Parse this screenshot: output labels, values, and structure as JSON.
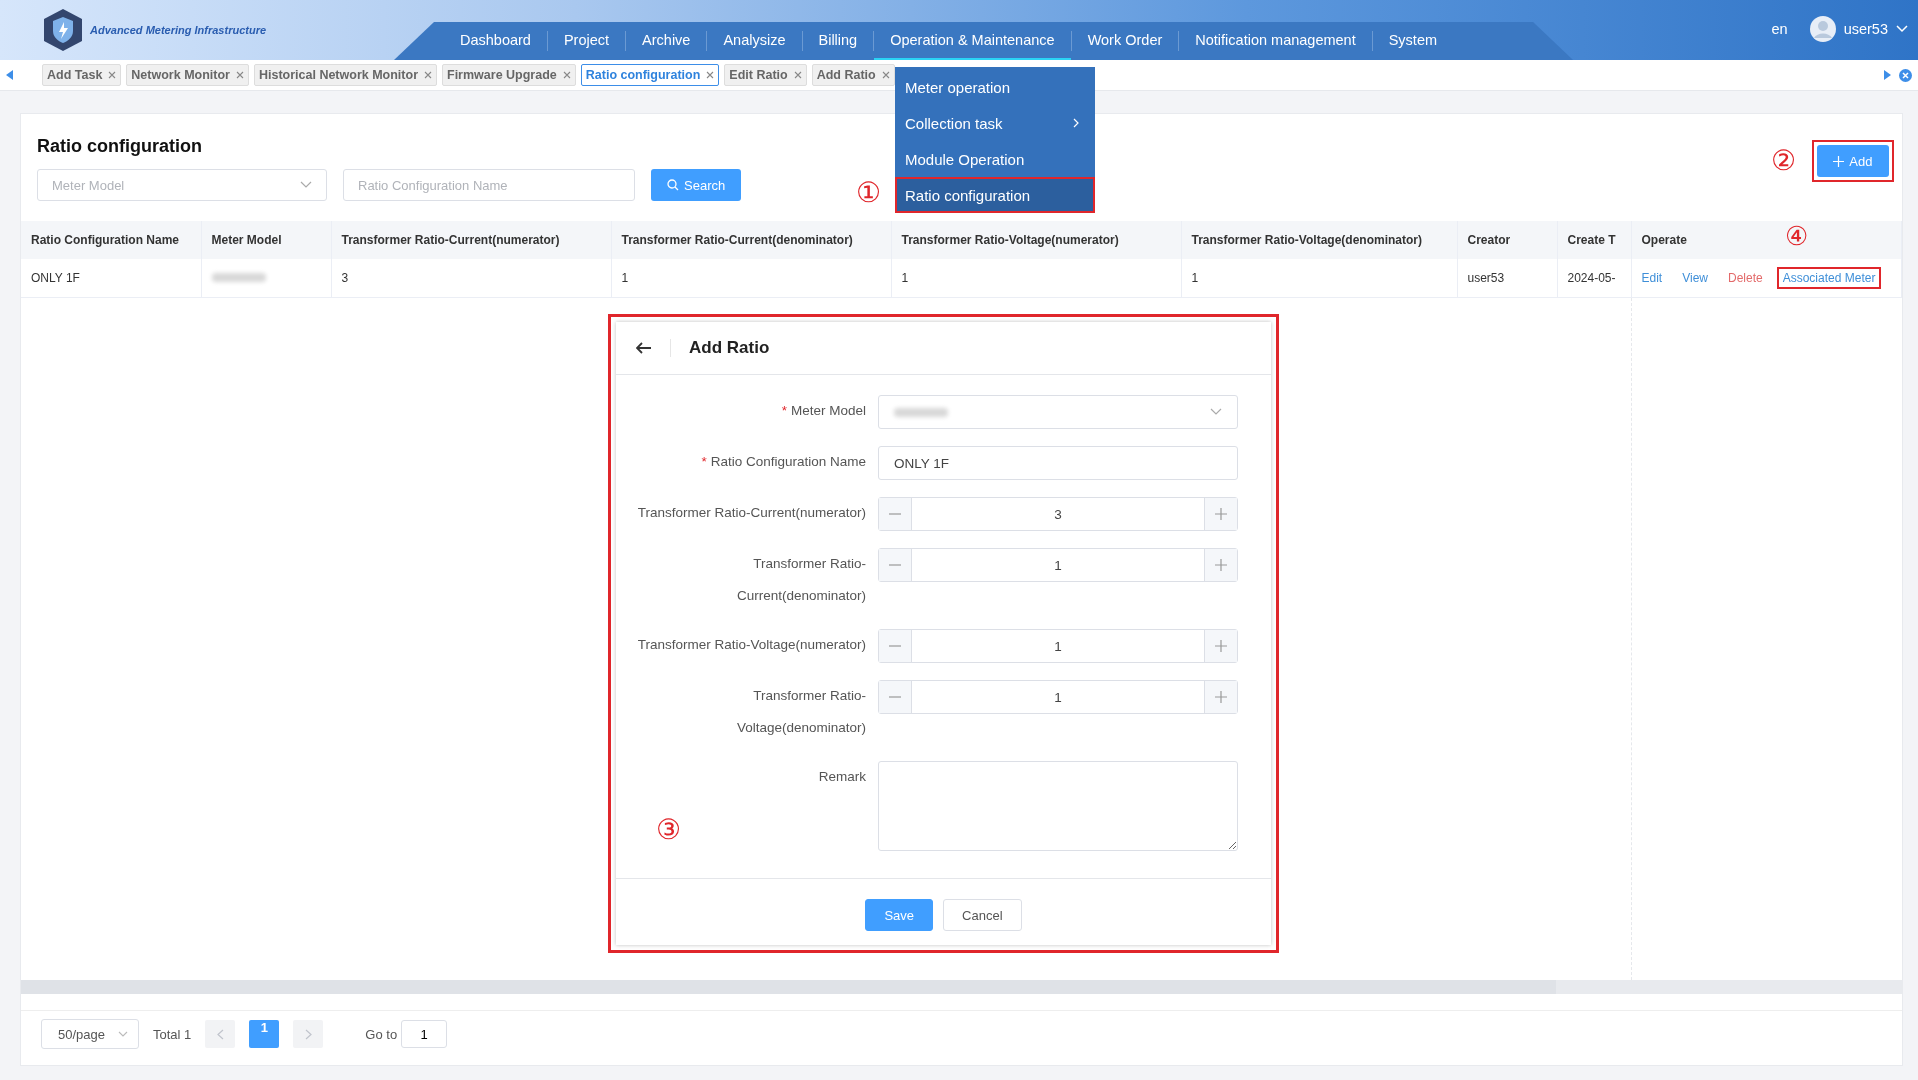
{
  "app": {
    "title": "Advanced Metering Infrastructure"
  },
  "nav": [
    {
      "label": "Dashboard",
      "selected": false
    },
    {
      "label": "Project",
      "selected": false
    },
    {
      "label": "Archive",
      "selected": false
    },
    {
      "label": "Analysize",
      "selected": false
    },
    {
      "label": "Billing",
      "selected": false
    },
    {
      "label": "Operation & Maintenance",
      "selected": true
    },
    {
      "label": "Work Order",
      "selected": false
    },
    {
      "label": "Notification management",
      "selected": false
    },
    {
      "label": "System",
      "selected": false
    }
  ],
  "user": {
    "language": "en",
    "name": "user53"
  },
  "tabs": [
    {
      "label": "Add Task",
      "selected": false
    },
    {
      "label": "Network Monitor",
      "selected": false
    },
    {
      "label": "Historical Network Monitor",
      "selected": false
    },
    {
      "label": "Firmware Upgrade",
      "selected": false
    },
    {
      "label": "Ratio configuration",
      "selected": true
    },
    {
      "label": "Edit Ratio",
      "selected": false
    },
    {
      "label": "Add Ratio",
      "selected": false
    }
  ],
  "menu": {
    "annotation": "①",
    "items": [
      {
        "label": "Meter operation",
        "selected": false,
        "has_submenu": false,
        "highlighted": false
      },
      {
        "label": "Collection task",
        "selected": false,
        "has_submenu": true,
        "highlighted": false
      },
      {
        "label": "Module Operation",
        "selected": false,
        "has_submenu": false,
        "highlighted": false
      },
      {
        "label": "Ratio configuration",
        "selected": true,
        "has_submenu": false,
        "highlighted": true
      }
    ]
  },
  "page": {
    "title": "Ratio configuration",
    "meter_model_placeholder": "Meter Model",
    "name_placeholder": "Ratio Configuration Name",
    "search_button": "Search",
    "add_button": {
      "label": "Add",
      "highlighted": true,
      "annotation": "②"
    }
  },
  "table": {
    "columns": [
      "Ratio Configuration Name",
      "Meter Model",
      "Transformer Ratio-Current(numerator)",
      "Transformer Ratio-Current(denominator)",
      "Transformer Ratio-Voltage(numerator)",
      "Transformer Ratio-Voltage(denominator)",
      "Creator",
      "Create T",
      "Operate"
    ],
    "rows": [
      {
        "cells": [
          {
            "kind": "text",
            "text": "ONLY 1F"
          },
          {
            "kind": "blurred"
          },
          {
            "kind": "text",
            "text": "3"
          },
          {
            "kind": "text",
            "text": "1"
          },
          {
            "kind": "text",
            "text": "1"
          },
          {
            "kind": "text",
            "text": "1"
          },
          {
            "kind": "text",
            "text": "user53"
          },
          {
            "kind": "text",
            "text": "2024-05-"
          }
        ],
        "actions": [
          {
            "label": "Edit",
            "kind": "link",
            "highlighted": false
          },
          {
            "label": "View",
            "kind": "link",
            "highlighted": false
          },
          {
            "label": "Delete",
            "kind": "danger",
            "highlighted": false
          },
          {
            "label": "Associated Meter",
            "kind": "link",
            "highlighted": true,
            "annotation": "④"
          }
        ]
      }
    ]
  },
  "dialog": {
    "title": "Add Ratio",
    "highlighted": true,
    "annotation": "③",
    "fields": [
      {
        "label": "Meter Model",
        "required_mark": "*",
        "kind": "select",
        "blurred": true
      },
      {
        "label": "Ratio Configuration Name",
        "required_mark": "*",
        "kind": "text",
        "value": "ONLY 1F"
      },
      {
        "label": "Transformer Ratio-Current(numerator)",
        "kind": "number",
        "value": "3"
      },
      {
        "label": "Transformer Ratio-Current(denominator)",
        "kind": "number",
        "value": "1"
      },
      {
        "label": "Transformer Ratio-Voltage(numerator)",
        "kind": "number",
        "value": "1"
      },
      {
        "label": "Transformer Ratio-Voltage(denominator)",
        "kind": "number",
        "value": "1"
      },
      {
        "label": "Remark",
        "kind": "textarea"
      }
    ],
    "buttons": [
      {
        "label": "Save",
        "kind": "primary"
      },
      {
        "label": "Cancel",
        "kind": "default"
      }
    ]
  },
  "pagination": {
    "page_size": "50/page",
    "total": "Total 1",
    "pages": [
      {
        "label": "1",
        "selected": true
      }
    ],
    "goto_label": "Go to",
    "goto_value": "1"
  }
}
